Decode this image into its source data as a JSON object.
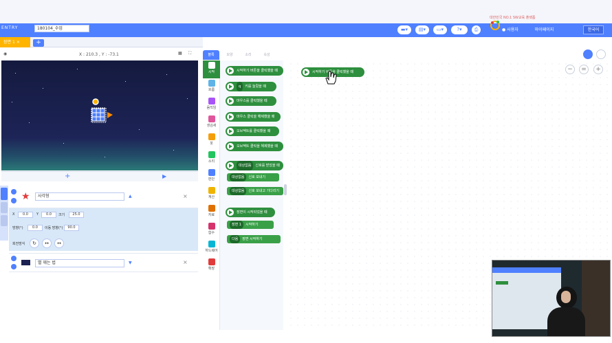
{
  "toolbar": {
    "logo": "ENTRY",
    "project_name": "180104_수업",
    "lang": "한국어",
    "user_name": "사용자",
    "my_page": "마이페이지",
    "promo": "대한민국 NO.1 SW교육 플랫폼"
  },
  "scene": {
    "tab_label": "장면 1",
    "add": "+"
  },
  "stage": {
    "coords": "X : 210.3 , Y : -73.1",
    "add_object": "+",
    "play": "▶"
  },
  "object": {
    "name": "사각형",
    "x_label": "X",
    "x_value": "0.0",
    "y_label": "Y",
    "y_value": "0.0",
    "size_label": "크기",
    "size_value": "25.0",
    "rotation_label": "방향(°)",
    "rotation_value": "0.0",
    "direction_label": "이동 방향(°)",
    "direction_value": "90.0",
    "rotation_method_label": "회전방식",
    "sub_item_label": "별 깨는 법"
  },
  "category_tabs": [
    "블록",
    "모양",
    "소리",
    "속성"
  ],
  "categories": [
    {
      "label": "시작",
      "color": "#2e8f3e"
    },
    {
      "label": "흐름",
      "color": "#5fb3e6"
    },
    {
      "label": "움직임",
      "color": "#a855f7"
    },
    {
      "label": "생김새",
      "color": "#e0569c"
    },
    {
      "label": "붓",
      "color": "#f59e0b"
    },
    {
      "label": "소리",
      "color": "#22c55e"
    },
    {
      "label": "판단",
      "color": "#4f80ff"
    },
    {
      "label": "계산",
      "color": "#f0b400"
    },
    {
      "label": "자료",
      "color": "#e07000"
    },
    {
      "label": "함수",
      "color": "#d6336c"
    },
    {
      "label": "하드웨어",
      "color": "#06b6d4"
    },
    {
      "label": "확장",
      "color": "#e03c3c"
    }
  ],
  "palette_blocks": [
    "시작하기 버튼을 클릭했을 때",
    "키를 눌렀을 때",
    "마우스를 클릭했을 때",
    "마우스 클릭을 해제했을 때",
    "오브젝트를 클릭했을 때",
    "오브젝트 클릭을 해제했을 때",
    "신호를 받았을 때",
    "신호 보내기",
    "신호 보내고 기다리기",
    "장면이 시작되었을 때",
    "시작하기",
    "장면 시작하기"
  ],
  "palette_pills": {
    "key": "q",
    "signal1": "대상없음",
    "signal2": "대상없음",
    "signal3": "대상없음",
    "scene1": "장면 1",
    "scene2": "다음"
  },
  "canvas_block": "시작하기 버튼을 클릭했을 때",
  "zoom": {
    "minus": "−",
    "reset": "=",
    "plus": "+"
  },
  "colors": {
    "accent": "#4f80ff",
    "start_block": "#2e8f3e",
    "scene_tab": "#ffb400"
  }
}
